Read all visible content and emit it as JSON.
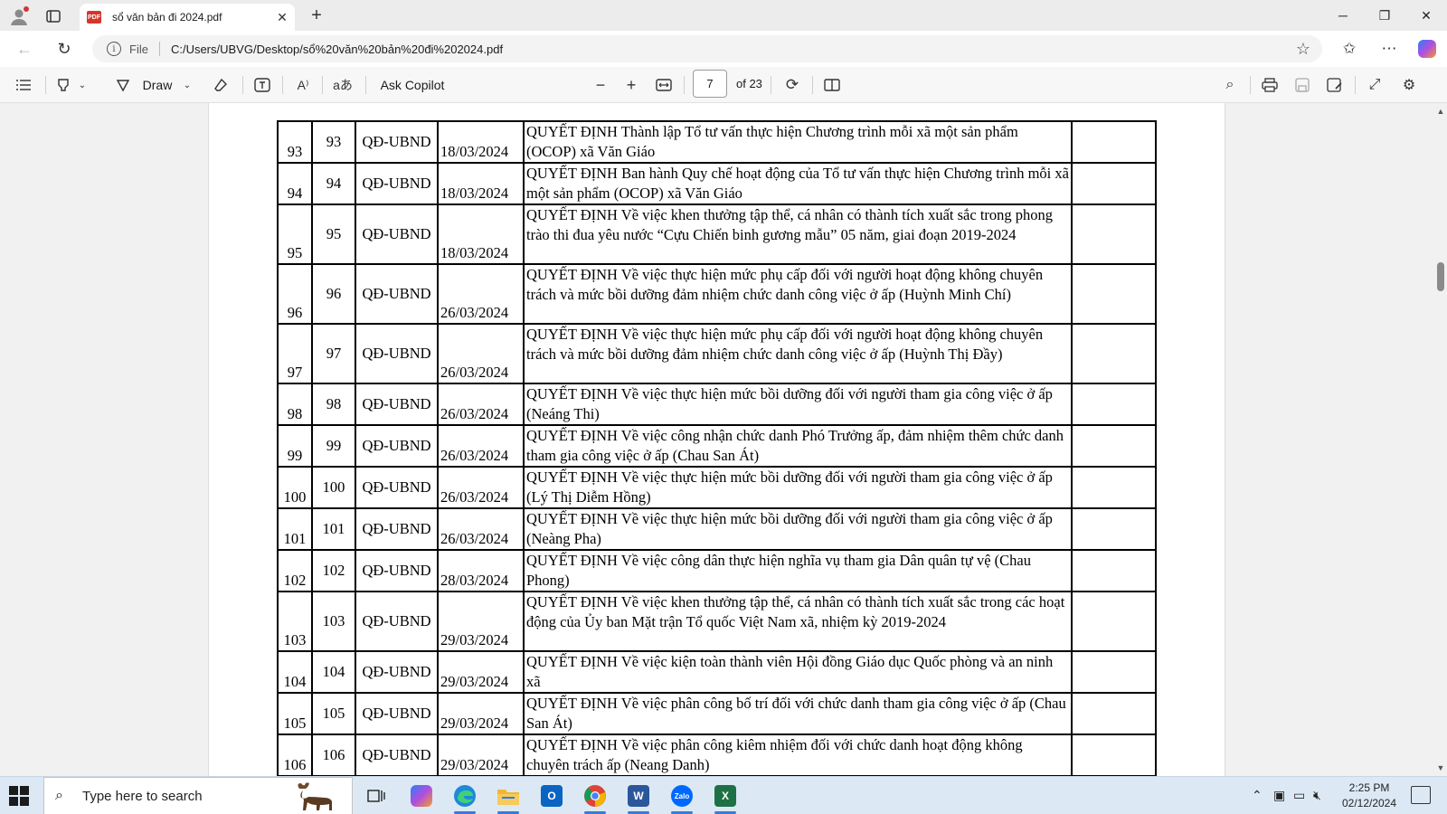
{
  "browser": {
    "tab_title": "sổ văn bản đi 2024.pdf",
    "address_prefix": "File",
    "url": "C:/Users/UBVG/Desktop/sổ%20văn%20bản%20đi%202024.pdf"
  },
  "pdf_toolbar": {
    "draw_label": "Draw",
    "ask_copilot_label": "Ask Copilot",
    "current_page": "7",
    "page_total": "of 23"
  },
  "document": {
    "rows": [
      {
        "stt": "93",
        "so": "93",
        "loai": "QĐ-UBND",
        "ngay": "18/03/2024",
        "trich_yeu": "QUYẾT ĐỊNH Thành lập Tổ tư vấn thực hiện Chương trình mỗi xã một sản phẩm (OCOP) xã Văn Giáo",
        "ghi_chu": ""
      },
      {
        "stt": "94",
        "so": "94",
        "loai": "QĐ-UBND",
        "ngay": "18/03/2024",
        "trich_yeu": "QUYẾT ĐỊNH Ban hành Quy chế hoạt động của Tổ tư vấn thực hiện Chương trình mỗi xã một sản phẩm (OCOP) xã Văn Giáo",
        "ghi_chu": ""
      },
      {
        "stt": "95",
        "so": "95",
        "loai": "QĐ-UBND",
        "ngay": "18/03/2024",
        "trich_yeu": "QUYẾT ĐỊNH Về việc khen thưởng tập thể, cá nhân có thành tích xuất sắc trong phong trào thi đua yêu nước “Cựu Chiến binh gương mẫu” 05 năm, giai đoạn 2019-2024",
        "ghi_chu": ""
      },
      {
        "stt": "96",
        "so": "96",
        "loai": "QĐ-UBND",
        "ngay": "26/03/2024",
        "trich_yeu": "QUYẾT ĐỊNH Về việc thực hiện mức phụ cấp đối với người hoạt động không chuyên trách và mức bồi dưỡng đảm nhiệm chức danh công việc ở ấp (Huỳnh Minh Chí)",
        "ghi_chu": ""
      },
      {
        "stt": "97",
        "so": "97",
        "loai": "QĐ-UBND",
        "ngay": "26/03/2024",
        "trich_yeu": "QUYẾT ĐỊNH Về việc thực hiện mức phụ cấp đối với người hoạt động không chuyên trách và mức bồi dưỡng đảm nhiệm chức danh công việc ở ấp (Huỳnh Thị Đầy)",
        "ghi_chu": ""
      },
      {
        "stt": "98",
        "so": "98",
        "loai": "QĐ-UBND",
        "ngay": "26/03/2024",
        "trich_yeu": "QUYẾT ĐỊNH Về việc thực hiện mức bồi dưỡng đối với người tham gia công việc ở ấp (Neáng Thi)",
        "ghi_chu": ""
      },
      {
        "stt": "99",
        "so": "99",
        "loai": "QĐ-UBND",
        "ngay": "26/03/2024",
        "trich_yeu": "QUYẾT ĐỊNH Về việc công nhận chức danh Phó Trưởng ấp, đảm nhiệm thêm chức danh tham gia công việc ở ấp (Chau San Át)",
        "ghi_chu": ""
      },
      {
        "stt": "100",
        "so": "100",
        "loai": "QĐ-UBND",
        "ngay": "26/03/2024",
        "trich_yeu": "QUYẾT ĐỊNH Về việc thực hiện mức bồi dưỡng đối với người tham gia công việc ở ấp (Lý Thị Diễm Hồng)",
        "ghi_chu": ""
      },
      {
        "stt": "101",
        "so": "101",
        "loai": "QĐ-UBND",
        "ngay": "26/03/2024",
        "trich_yeu": "QUYẾT ĐỊNH Về việc thực hiện mức bồi dưỡng đối với người tham gia công việc ở ấp (Neàng Pha)",
        "ghi_chu": ""
      },
      {
        "stt": "102",
        "so": "102",
        "loai": "QĐ-UBND",
        "ngay": "28/03/2024",
        "trich_yeu": "QUYẾT ĐỊNH Về việc công dân thực hiện nghĩa vụ tham gia Dân quân tự vệ (Chau Phong)",
        "ghi_chu": ""
      },
      {
        "stt": "103",
        "so": "103",
        "loai": "QĐ-UBND",
        "ngay": "29/03/2024",
        "trich_yeu": "QUYẾT ĐỊNH Về việc khen thưởng tập thể, cá nhân có thành tích xuất sắc trong các hoạt động của Ủy ban Mặt trận Tổ quốc Việt Nam xã, nhiệm kỳ 2019-2024",
        "ghi_chu": ""
      },
      {
        "stt": "104",
        "so": "104",
        "loai": "QĐ-UBND",
        "ngay": "29/03/2024",
        "trich_yeu": "QUYẾT ĐỊNH Về việc kiện toàn thành viên Hội đồng Giáo dục Quốc phòng và an ninh xã",
        "ghi_chu": ""
      },
      {
        "stt": "105",
        "so": "105",
        "loai": "QĐ-UBND",
        "ngay": "29/03/2024",
        "trich_yeu": "QUYẾT ĐỊNH Về việc phân công bố trí đối với chức danh tham gia công việc ở ấp (Chau San Át)",
        "ghi_chu": ""
      },
      {
        "stt": "106",
        "so": "106",
        "loai": "QĐ-UBND",
        "ngay": "29/03/2024",
        "trich_yeu": "QUYẾT ĐỊNH Về việc phân công kiêm nhiệm đối với chức danh hoạt động không chuyên trách ấp (Neang Danh)",
        "ghi_chu": ""
      }
    ]
  },
  "taskbar": {
    "search_placeholder": "Type here to search",
    "time": "2:25 PM",
    "date": "02/12/2024",
    "apps": [
      "task-view",
      "copilot",
      "edge",
      "file-explorer",
      "outlook",
      "chrome",
      "word",
      "zalo",
      "excel"
    ]
  },
  "colors": {
    "pdf_badge": "#d6362a",
    "taskbar_bg": "#dce9f5",
    "accent": "#3a7bd5"
  }
}
